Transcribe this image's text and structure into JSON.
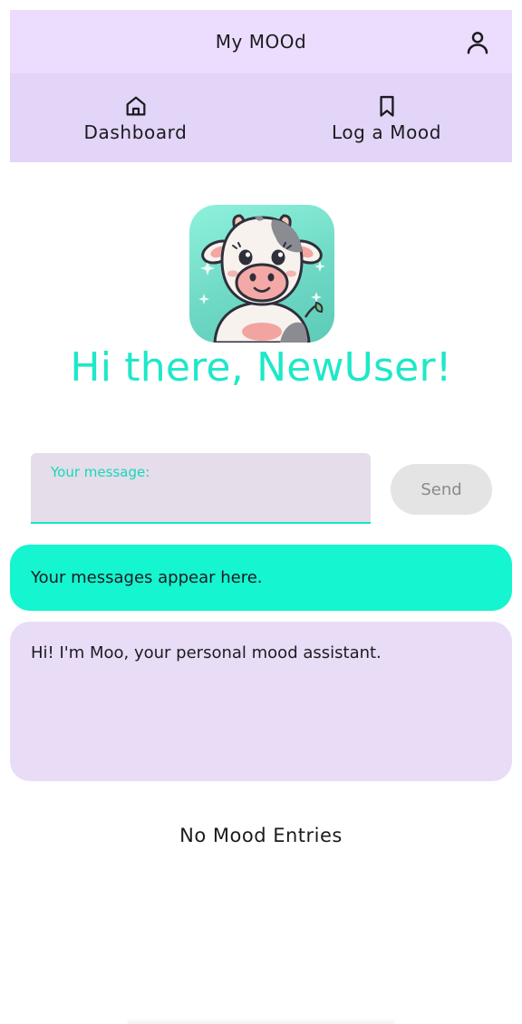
{
  "app_bar": {
    "title": "My MOOd",
    "account_icon": "person-outline-icon"
  },
  "nav": {
    "tabs": [
      {
        "label": "Dashboard",
        "icon": "home-outline-icon"
      },
      {
        "label": "Log a Mood",
        "icon": "bookmark-outline-icon"
      }
    ]
  },
  "hero": {
    "avatar_icon": "cow-mascot-image",
    "greeting": "Hi there, NewUser!"
  },
  "chat": {
    "input_label": "Your message:",
    "input_value": "",
    "send_label": "Send",
    "user_message": "Your messages appear here.",
    "assistant_message": "Hi! I'm Moo, your personal mood assistant."
  },
  "entries": {
    "empty_text": "No Mood Entries"
  },
  "colors": {
    "accent": "#14f5d0",
    "top_bar": "#ecdcfe",
    "nav_bar": "#e2d5f7",
    "assistant_bubble": "#e8dcf6"
  }
}
